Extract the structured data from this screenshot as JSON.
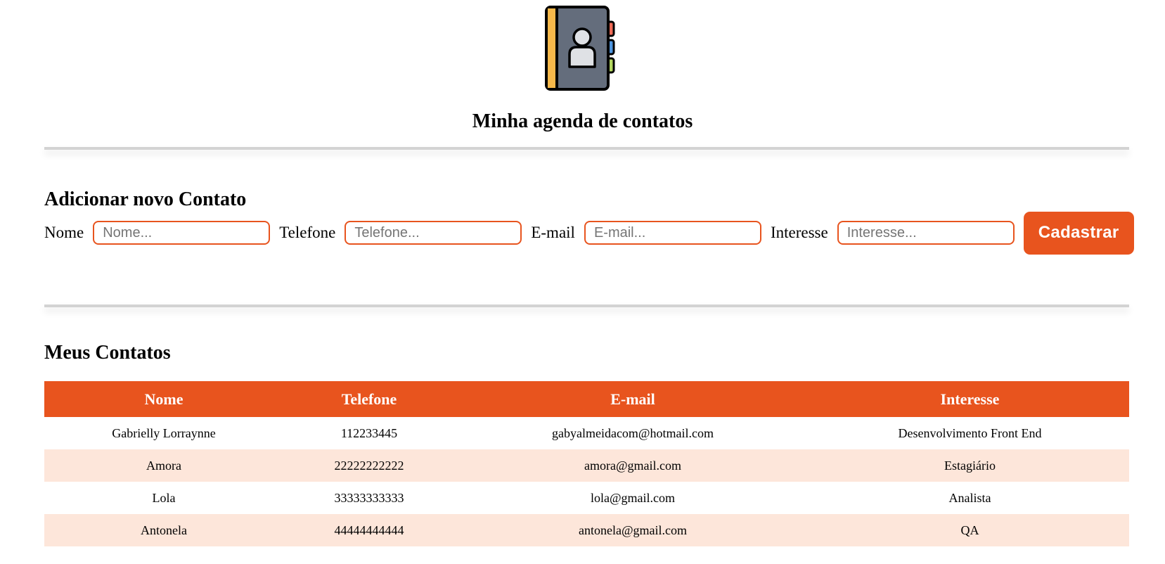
{
  "header": {
    "title": "Minha agenda de contatos",
    "logo_icon": "contact-book-icon"
  },
  "form": {
    "title": "Adicionar novo Contato",
    "fields": [
      {
        "label": "Nome",
        "placeholder": "Nome...",
        "value": ""
      },
      {
        "label": "Telefone",
        "placeholder": "Telefone...",
        "value": ""
      },
      {
        "label": "E-mail",
        "placeholder": "E-mail...",
        "value": ""
      },
      {
        "label": "Interesse",
        "placeholder": "Interesse...",
        "value": ""
      }
    ],
    "submit_label": "Cadastrar"
  },
  "contacts": {
    "title": "Meus Contatos",
    "columns": [
      "Nome",
      "Telefone",
      "E-mail",
      "Interesse"
    ],
    "rows": [
      [
        "Gabrielly Lorraynne",
        "112233445",
        "gabyalmeidacom@hotmail.com",
        "Desenvolvimento Front End"
      ],
      [
        "Amora",
        "22222222222",
        "amora@gmail.com",
        "Estagiário"
      ],
      [
        "Lola",
        "33333333333",
        "lola@gmail.com",
        "Analista"
      ],
      [
        "Antonela",
        "44444444444",
        "antonela@gmail.com",
        "QA"
      ]
    ]
  },
  "colors": {
    "accent": "#e8541e",
    "row_alt": "#fde6da",
    "divider": "#d3d3d3"
  }
}
